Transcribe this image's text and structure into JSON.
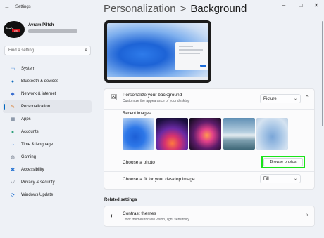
{
  "window": {
    "app_title": "Settings",
    "back_icon": "arrow-left-icon",
    "minimize_icon": "minimize-icon",
    "maximize_icon": "maximize-icon",
    "close_icon": "close-icon"
  },
  "profile": {
    "name": "Avram Piltch",
    "avatar_text": "Tom's",
    "avatar_badge": "HW"
  },
  "search": {
    "placeholder": "Find a setting",
    "icon": "search-icon"
  },
  "nav": {
    "items": [
      {
        "label": "System",
        "icon": "monitor-icon",
        "color": "#3b82d6"
      },
      {
        "label": "Bluetooth & devices",
        "icon": "bluetooth-icon",
        "color": "#0f6cbd"
      },
      {
        "label": "Network & internet",
        "icon": "wifi-icon",
        "color": "#3b6fd0"
      },
      {
        "label": "Personalization",
        "icon": "brush-icon",
        "color": "#d87a2a",
        "active": true
      },
      {
        "label": "Apps",
        "icon": "apps-icon",
        "color": "#5a6a82"
      },
      {
        "label": "Accounts",
        "icon": "person-icon",
        "color": "#2fa07a"
      },
      {
        "label": "Time & language",
        "icon": "globe-clock-icon",
        "color": "#2d78d4"
      },
      {
        "label": "Gaming",
        "icon": "gamepad-icon",
        "color": "#6c7686"
      },
      {
        "label": "Accessibility",
        "icon": "accessibility-icon",
        "color": "#1f6fd1"
      },
      {
        "label": "Privacy & security",
        "icon": "shield-icon",
        "color": "#6b7380"
      },
      {
        "label": "Windows Update",
        "icon": "update-icon",
        "color": "#1f6fd1"
      }
    ]
  },
  "breadcrumb": {
    "parent": "Personalization",
    "separator": ">",
    "current": "Background"
  },
  "personalize": {
    "title": "Personalize your background",
    "subtitle": "Customize the appearance of your desktop",
    "value": "Picture",
    "icon": "image-icon"
  },
  "recent": {
    "label": "Recent images"
  },
  "choose_photo": {
    "label": "Choose a photo",
    "button": "Browse photos"
  },
  "fit": {
    "label": "Choose a fit for your desktop image",
    "value": "Fill"
  },
  "related": {
    "heading": "Related settings",
    "contrast_title": "Contrast themes",
    "contrast_sub": "Color themes for low vision, light sensitivity",
    "icon": "contrast-icon"
  },
  "colors": {
    "accent": "#0067c0",
    "highlight": "#19e319"
  }
}
